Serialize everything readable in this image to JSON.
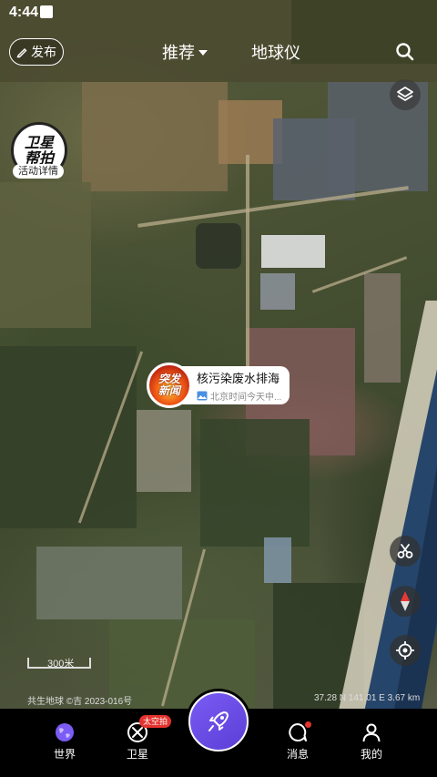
{
  "status_bar": {
    "time": "4:44"
  },
  "header": {
    "publish_label": "发布",
    "tabs": [
      {
        "label": "推荐",
        "active": true
      },
      {
        "label": "地球仪",
        "active": false
      }
    ]
  },
  "satellite_badge": {
    "line1": "卫星",
    "line2": "帮拍",
    "caption": "活动详情"
  },
  "news_marker": {
    "badge_line1": "突发",
    "badge_line2": "新闻",
    "title": "核污染废水排海",
    "subtitle": "北京时间今天中..."
  },
  "map_footer": {
    "scale_label": "300米",
    "copyright": "共生地球 ©吉 2023-016号",
    "coords": "37.28 N 141.01 E 3.67 km"
  },
  "bottom_nav": {
    "items": [
      {
        "label": "世界",
        "icon": "globe-icon"
      },
      {
        "label": "卫星",
        "icon": "satellite-icon",
        "badge": "太空拍"
      },
      {
        "label": "消息",
        "icon": "message-icon"
      },
      {
        "label": "我的",
        "icon": "profile-icon"
      }
    ]
  },
  "colors": {
    "accent": "#6a4ce8",
    "badge_red": "#e2332e"
  }
}
